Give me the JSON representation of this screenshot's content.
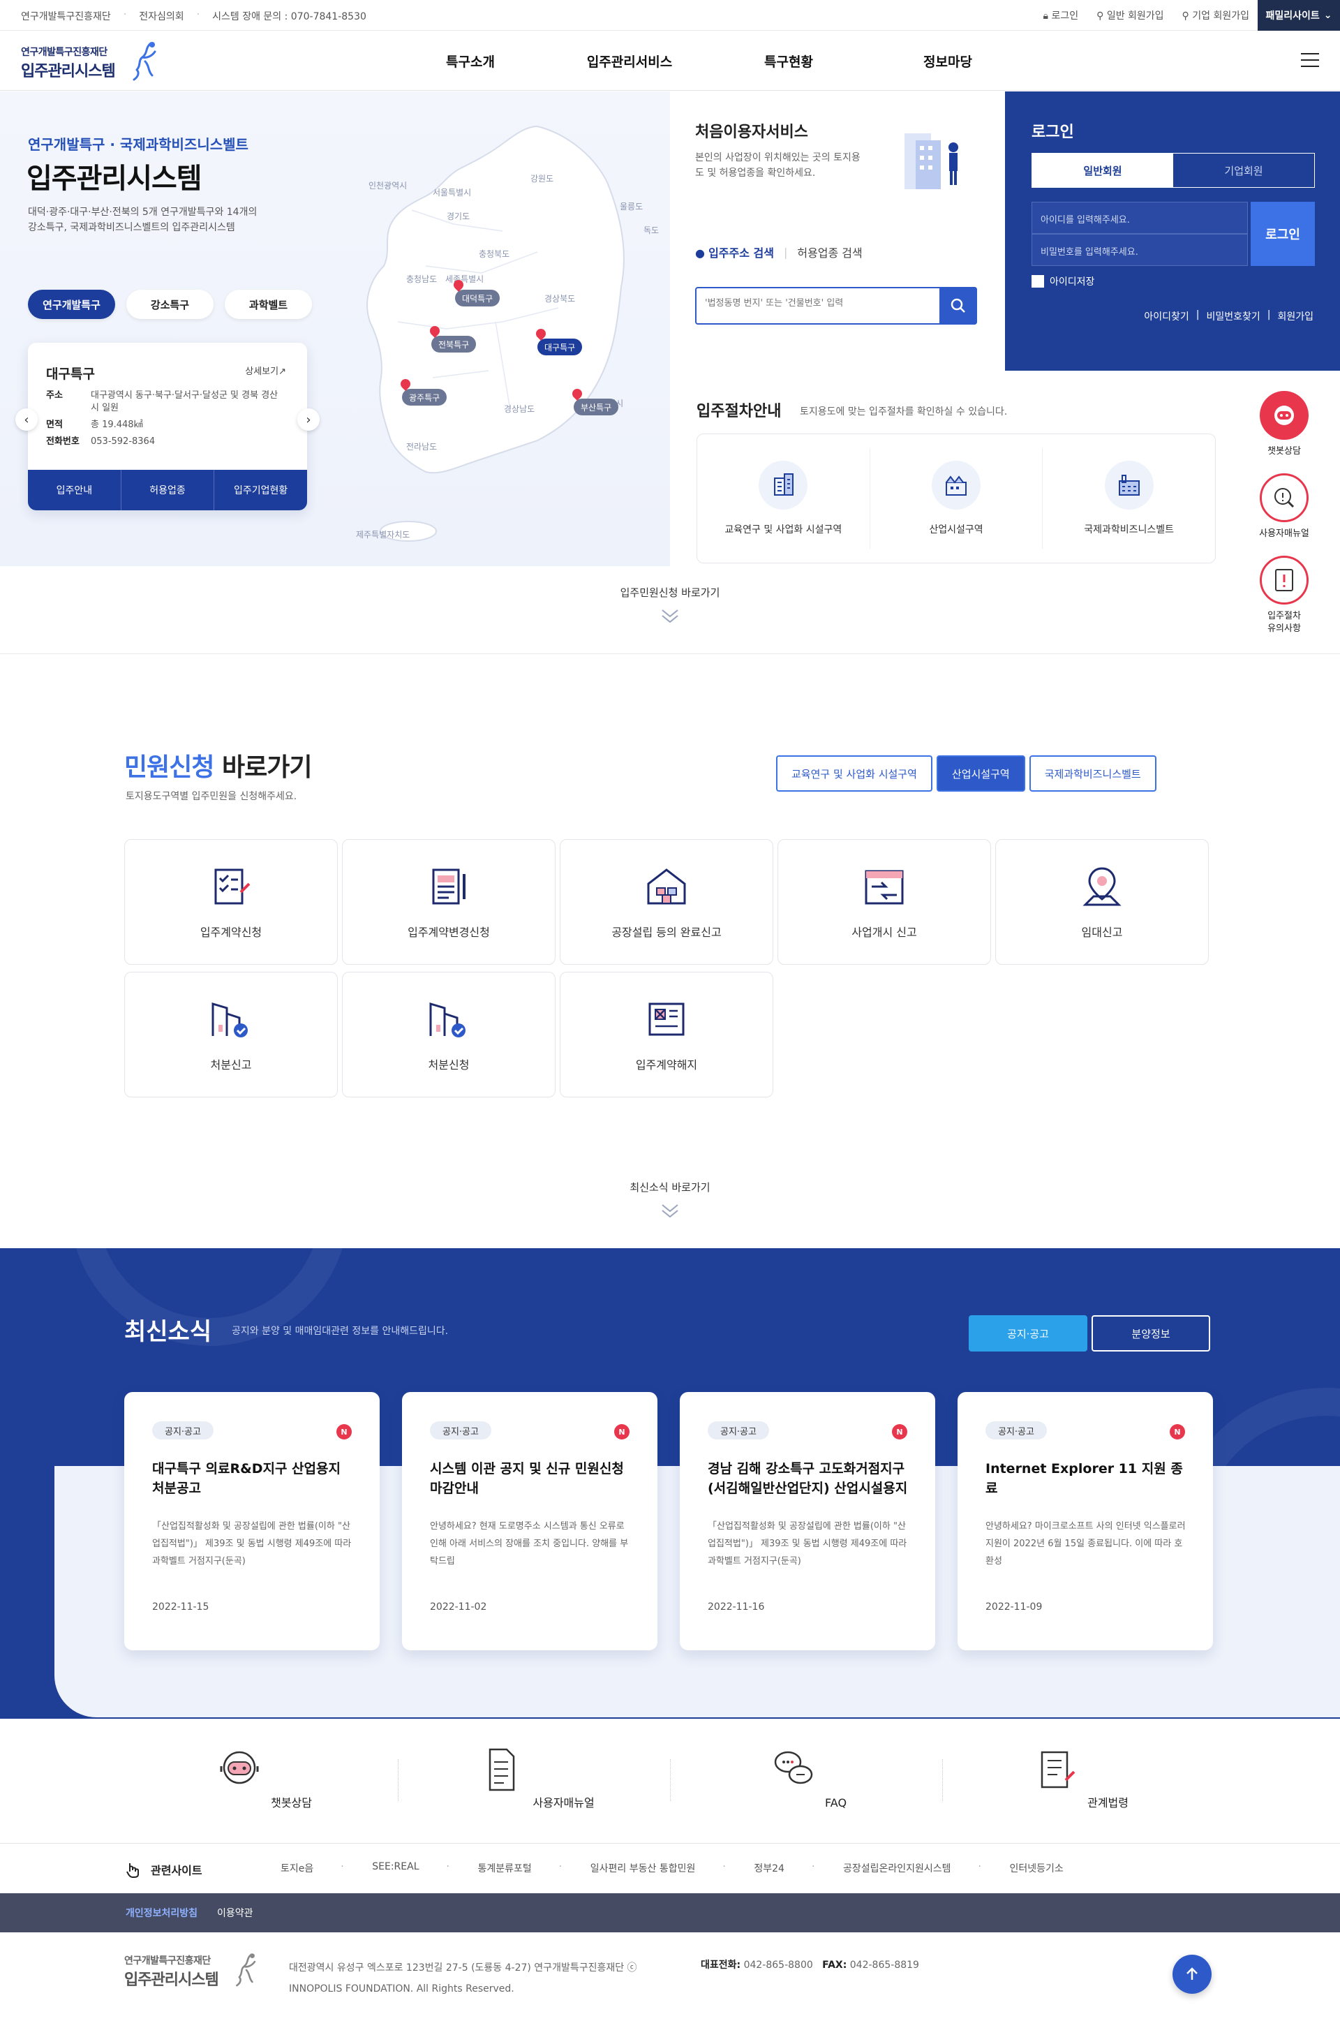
{
  "topbar": {
    "links": [
      "연구개발특구진흥재단",
      "전자심의회",
      "시스템 장애 문의 : 070-7841-8530"
    ],
    "right": [
      "로그인",
      "일반 회원가입",
      "기업 회원가입"
    ],
    "family_site": "패밀리사이트"
  },
  "header": {
    "logo_small": "연구개발특구진흥재단",
    "logo_big": "입주관리시스템",
    "nav": [
      "특구소개",
      "입주관리서비스",
      "특구현황",
      "정보마당"
    ]
  },
  "hero": {
    "subtitle": "연구개발특구 · 국제과학비즈니스벨트",
    "title": "입주관리시스템",
    "desc": "대덕·광주·대구·부산·전북의 5개 연구개발특구와 14개의 강소특구, 국제과학비즈니스벨트의 입주관리시스템",
    "tabs": [
      "연구개발특구",
      "강소특구",
      "과학벨트"
    ],
    "zone": {
      "name": "대구특구",
      "more": "상세보기",
      "rows": [
        {
          "k": "주소",
          "v": "대구광역시 동구·북구·달서구·달성군 및 경북 경산시 일원"
        },
        {
          "k": "면적",
          "v": "총 19.448㎢"
        },
        {
          "k": "전화번호",
          "v": "053-592-8364"
        }
      ],
      "buttons": [
        "입주안내",
        "허용업종",
        "입주기업현황"
      ]
    },
    "map_labels": [
      "인천광역시",
      "서울특별시",
      "강원도",
      "경기도",
      "울릉도",
      "독도",
      "충청북도",
      "충청남도",
      "세종특별시",
      "경상북도",
      "경상남도",
      "울산광역시",
      "전라남도",
      "제주특별자치도"
    ],
    "map_pins": [
      "대덕특구",
      "전북특구",
      "대구특구",
      "광주특구",
      "부산특구"
    ]
  },
  "first_user": {
    "title": "처음이용자서비스",
    "desc": "본인의 사업장이 위치해있는 곳의 토지용도 및 허용업종을 확인하세요.",
    "option_on": "입주주소 검색",
    "option_off": "허용업종 검색",
    "placeholder": "'법정동명 번지' 또는 '건물번호' 입력"
  },
  "login": {
    "title": "로그인",
    "tabs": [
      "일반회원",
      "기업회원"
    ],
    "id_placeholder": "아이디를 입력해주세요.",
    "pw_placeholder": "비밀번호를 입력해주세요.",
    "button": "로그인",
    "save_id": "아이디저장",
    "links": [
      "아이디찾기",
      "비밀번호찾기",
      "회원가입"
    ]
  },
  "procedure": {
    "title": "입주절차안내",
    "subtitle": "토지용도에 맞는 입주절차를 확인하실 수 있습니다.",
    "items": [
      "교육연구 및 사업화 시설구역",
      "산업시설구역",
      "국제과학비즈니스벨트"
    ]
  },
  "side_quick": [
    "챗봇상담",
    "사용자매뉴얼",
    "입주절차 유의사항"
  ],
  "goto1": "입주민원신청 바로가기",
  "minwon": {
    "title_accent": "민원신청",
    "title_rest": " 바로가기",
    "subtitle": "토지용도구역별 입주민원을 신청해주세요.",
    "tabs": [
      "교육연구 및 사업화 시설구역",
      "산업시설구역",
      "국제과학비즈니스벨트"
    ],
    "items": [
      "입주계약신청",
      "입주계약변경신청",
      "공장설립 등의 완료신고",
      "사업개시 신고",
      "임대신고",
      "처분신고",
      "처분신청",
      "입주계약해지"
    ]
  },
  "goto2": "최신소식 바로가기",
  "news": {
    "title": "최신소식",
    "subtitle": "공지와 분양 및 매매임대관련 정보를 안내해드립니다.",
    "tabs": [
      "공지·공고",
      "분양정보"
    ],
    "cards": [
      {
        "tag": "공지·공고",
        "badge": "N",
        "title": "대구특구 의료R&D지구 산업용지 처분공고",
        "desc": "「산업집적활성화 및 공장설립에 관한 법률(이하 \"산업집적법\")」 제39조 및 동법 시행령 제49조에 따라 과학벨트 거점지구(둔곡)",
        "date": "2022-11-15"
      },
      {
        "tag": "공지·공고",
        "badge": "N",
        "title": "시스템 이관 공지 및 신규 민원신청 마감안내",
        "desc": "안녕하세요? 현재 도로명주소 시스템과 통신 오류로 인해 아래 서비스의 장애를 조치 중입니다. 양해를 부탁드립",
        "date": "2022-11-02"
      },
      {
        "tag": "공지·공고",
        "badge": "N",
        "title": "경남 김해 강소특구 고도화거점지구(서김해일반산업단지) 산업시설용지",
        "desc": "「산업집적활성화 및 공장설립에 관한 법률(이하 \"산업집적법\")」 제39조 및 동법 시행령 제49조에 따라 과학벨트 거점지구(둔곡)",
        "date": "2022-11-16"
      },
      {
        "tag": "공지·공고",
        "badge": "N",
        "title": "Internet Explorer 11 지원 종료",
        "desc": "안녕하세요? 마이크로소프트 사의 인터넷 익스플로러 지원이 2022년 6월 15일 종료됩니다. 이에 따라 호환성",
        "date": "2022-11-09"
      }
    ]
  },
  "bottom_quick": [
    "챗봇상담",
    "사용자매뉴얼",
    "FAQ",
    "관계법령"
  ],
  "related": {
    "title": "관련사이트",
    "links": [
      "토지e음",
      "SEE:REAL",
      "통계분류포털",
      "일사편리 부동산 통합민원",
      "정부24",
      "공장설립온라인지원시스템",
      "인터넷등기소"
    ]
  },
  "footer": {
    "privacy": "개인정보처리방침",
    "terms": "이용약관",
    "logo_small": "연구개발특구진흥재단",
    "logo_big": "입주관리시스템",
    "address": "대전광역시 유성구 엑스포로 123번길 27-5 (도룡동 4-27) 연구개발특구진흥재단 ⓒ",
    "copyright": "INNOPOLIS FOUNDATION. All Rights Reserved.",
    "tel_label": "대표전화:",
    "tel": "042-865-8800",
    "fax_label": "FAX:",
    "fax": "042-865-8819"
  }
}
